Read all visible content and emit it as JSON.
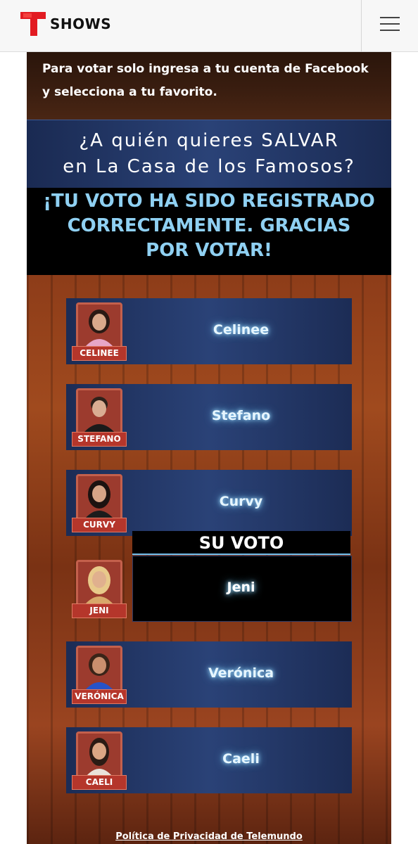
{
  "header": {
    "brand": "SHOWS",
    "logo_icon": "telemundo-t-logo-icon",
    "menu_icon": "hamburger-menu-icon",
    "brand_color": "#e21b22"
  },
  "vote": {
    "intro": "Para votar solo ingresa a tu cuenta de Facebook y selecciona a tu favorito.",
    "question_line1": "¿A quién quieres SALVAR",
    "question_line2": "en La Casa de los Famosos?",
    "confirm_line1": "¡TU VOTO HA SIDO REGISTRADO",
    "confirm_line2": "CORRECTAMENTE. GRACIAS",
    "confirm_line3": "POR VOTAR!",
    "voted_label": "SU VOTO",
    "candidates": [
      {
        "name": "Celinee",
        "tag": "CELINEE",
        "skin": "#d9a98b",
        "hair": "#2a1a14",
        "outfit": "#e7a6c7"
      },
      {
        "name": "Stefano",
        "tag": "STEFANO",
        "skin": "#d9ad92",
        "hair": "#2e211a",
        "outfit": "#1a1a1a"
      },
      {
        "name": "Curvy",
        "tag": "CURVY",
        "skin": "#d6a487",
        "hair": "#1c1210",
        "outfit": "#1c1c1c"
      },
      {
        "name": "Jeni",
        "tag": "JENI",
        "skin": "#e0b08e",
        "hair": "#e8c98a",
        "outfit": "#d8a86a"
      },
      {
        "name": "Verónica",
        "tag": "VERÓNICA",
        "skin": "#c98f6e",
        "hair": "#3a2418",
        "outfit": "#2753c9"
      },
      {
        "name": "Caeli",
        "tag": "CAELI",
        "skin": "#dba684",
        "hair": "#2b1b14",
        "outfit": "#e9e2da"
      }
    ],
    "voted_index": 3
  },
  "footer": {
    "privacy_link": "Política de Privacidad de Telemundo"
  }
}
